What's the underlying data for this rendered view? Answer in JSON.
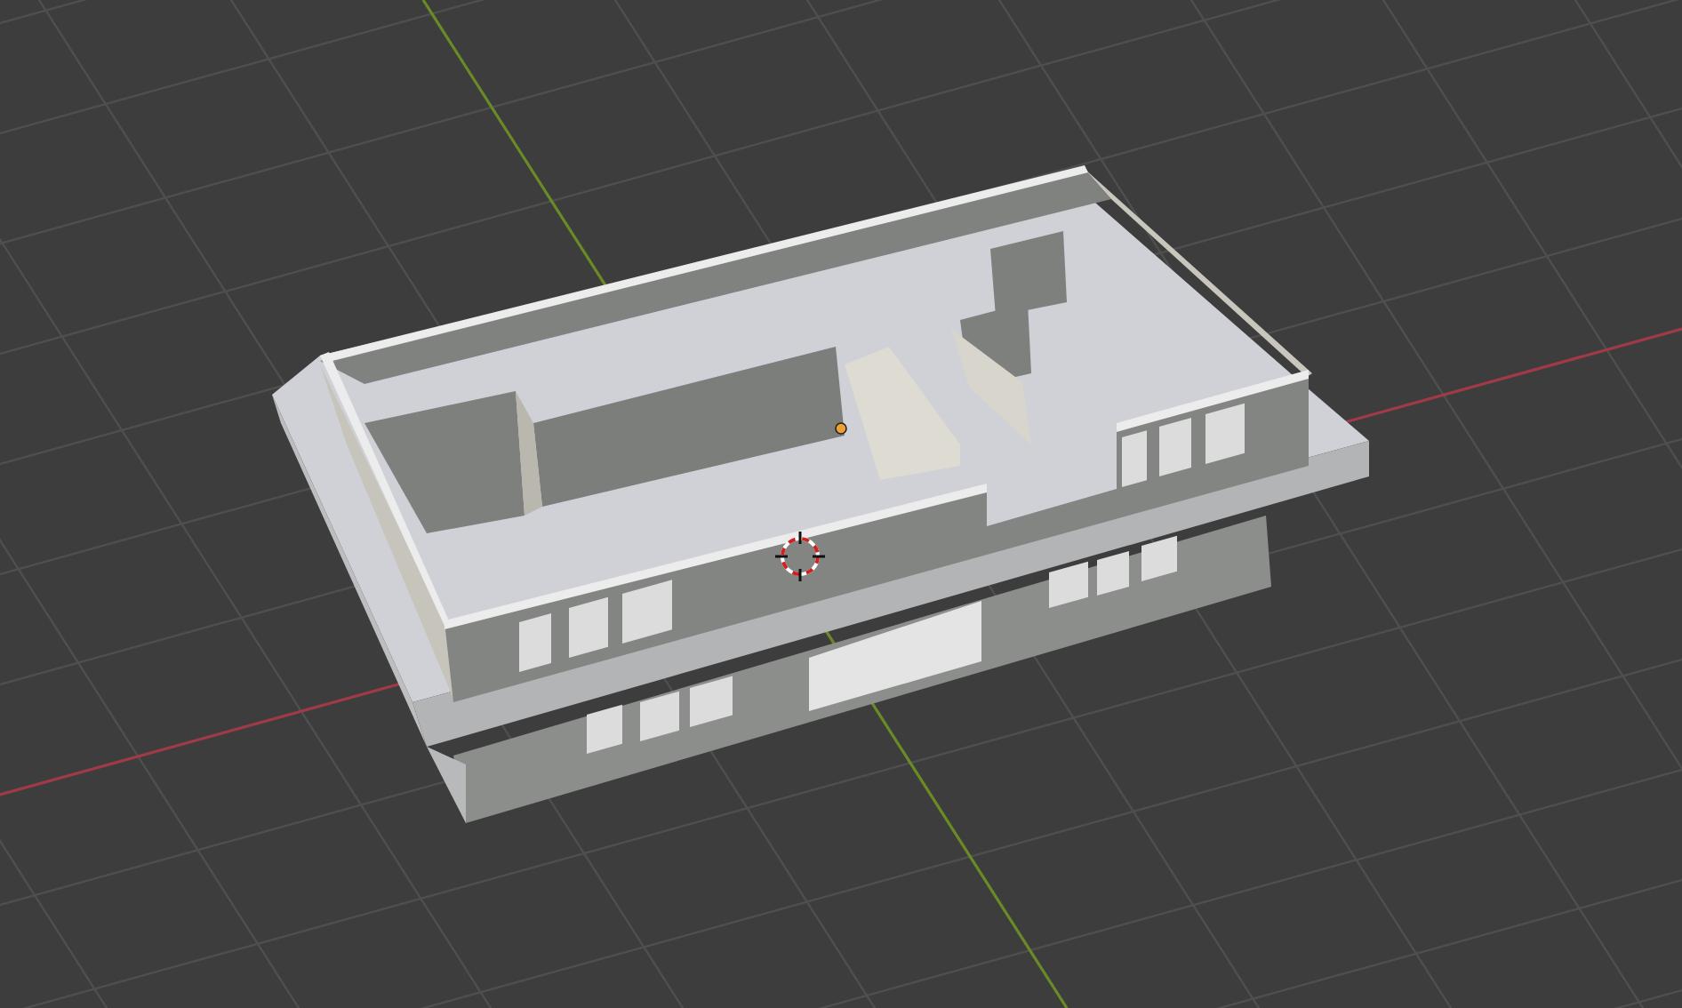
{
  "viewport": {
    "grid": true,
    "axes": true,
    "cursor": true,
    "origin": true
  }
}
